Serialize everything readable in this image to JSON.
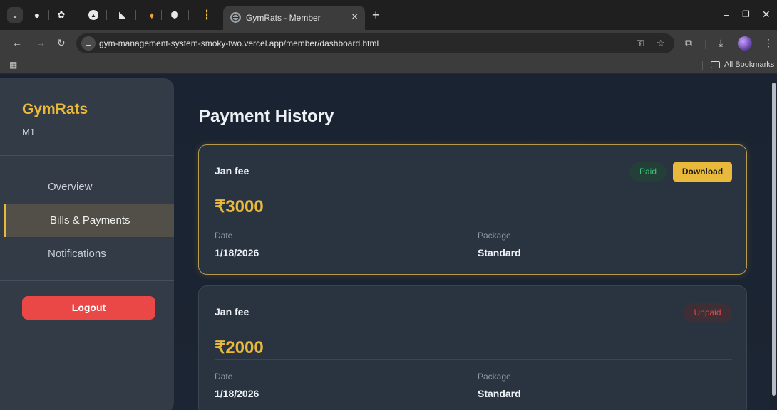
{
  "browser": {
    "tab_title": "GymRats - Member",
    "url": "gym-management-system-smoky-two.vercel.app/member/dashboard.html",
    "all_bookmarks": "All Bookmarks"
  },
  "sidebar": {
    "brand": "GymRats",
    "member_id": "M1",
    "items": [
      {
        "label": "Overview",
        "active": false
      },
      {
        "label": "Bills & Payments",
        "active": true
      },
      {
        "label": "Notifications",
        "active": false
      }
    ],
    "logout_label": "Logout"
  },
  "main": {
    "title": "Payment History",
    "payments": [
      {
        "label": "Jan fee",
        "amount": "₹3000",
        "status": "Paid",
        "download_label": "Download",
        "date_label": "Date",
        "date": "1/18/2026",
        "package_label": "Package",
        "package": "Standard"
      },
      {
        "label": "Jan fee",
        "amount": "₹2000",
        "status": "Unpaid",
        "date_label": "Date",
        "date": "1/18/2026",
        "package_label": "Package",
        "package": "Standard"
      }
    ]
  },
  "colors": {
    "accent": "#e8b93a",
    "paid": "#3ec27a",
    "unpaid": "#e04848",
    "logout": "#ea4747"
  }
}
